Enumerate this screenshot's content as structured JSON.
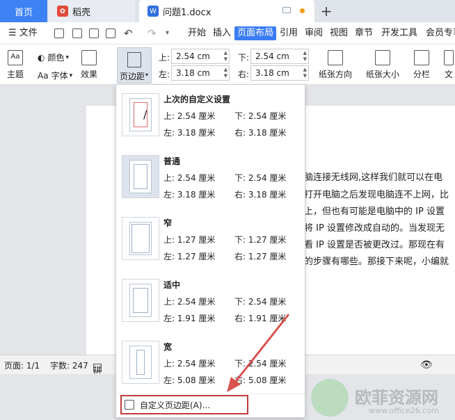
{
  "titlebar": {
    "tab_home": "首页",
    "tab_daoke": "稻壳",
    "tab_doc": "问题1.docx",
    "tab_add": "+",
    "colors": {
      "accent": "#3c82f5",
      "unsaved_dot": "#f39c12"
    }
  },
  "menubar": {
    "file_label": "文件",
    "items": [
      "开始",
      "插入",
      "页面布局",
      "引用",
      "审阅",
      "视图",
      "章节",
      "开发工具",
      "会员专享"
    ],
    "active": "页面布局"
  },
  "ribbon": {
    "theme": "主题",
    "colors": "颜色",
    "font": "字体",
    "effects": "效果",
    "margins": "页边距",
    "top_label": "上:",
    "top_value": "2.54 cm",
    "bottom_label": "下:",
    "bottom_value": "2.54 cm",
    "left_label": "左:",
    "left_value": "3.18 cm",
    "right_label": "右:",
    "right_value": "3.18 cm",
    "orientation": "纸张方向",
    "size": "纸张大小",
    "columns": "分栏",
    "text_cut": "文"
  },
  "document": {
    "lines": [
      "脑连接无线网,这样我们就可以在电",
      "打开电脑之后发现电脑连不上网，比",
      "上，但也有可能是电脑中的 IP 设置",
      "将 IP 设置修改成自动的。当发现无",
      "看 IP 设置是否被更改过。那现在有",
      "的步骤有哪些。那接下来呢，小编就"
    ]
  },
  "statusbar": {
    "page": "页面: 1/1",
    "words": "字数: 247",
    "spell": "拼写"
  },
  "dropdown": {
    "presets": [
      {
        "name": "上次的自定义设置",
        "top": "上: 2.54 厘米",
        "bottom": "下: 2.54 厘米",
        "left": "左: 3.18 厘米",
        "right": "右: 3.18 厘米"
      },
      {
        "name": "普通",
        "top": "上: 2.54 厘米",
        "bottom": "下: 2.54 厘米",
        "left": "左: 3.18 厘米",
        "right": "右: 3.18 厘米"
      },
      {
        "name": "窄",
        "top": "上: 1.27 厘米",
        "bottom": "下: 1.27 厘米",
        "left": "左: 1.27 厘米",
        "right": "右: 1.27 厘米"
      },
      {
        "name": "适中",
        "top": "上: 2.54 厘米",
        "bottom": "下: 2.54 厘米",
        "left": "左: 1.91 厘米",
        "right": "右: 1.91 厘米"
      },
      {
        "name": "宽",
        "top": "上: 2.54 厘米",
        "bottom": "下: 2.54 厘米",
        "left": "左: 5.08 厘米",
        "right": "右: 5.08 厘米"
      }
    ],
    "custom": "自定义页边距(A)..."
  },
  "watermark": {
    "title": "欧菲资源网",
    "url": "www.office26.com"
  },
  "annotation_color": "#d9534f"
}
